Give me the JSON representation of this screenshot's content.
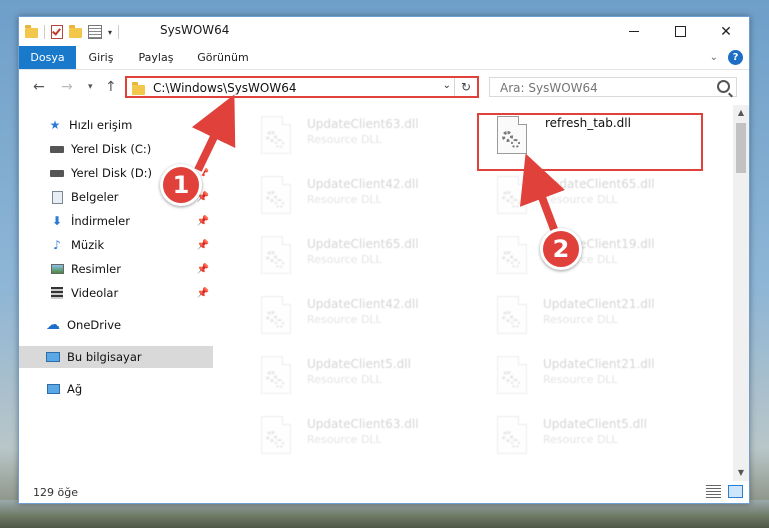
{
  "window": {
    "title": "SysWOW64"
  },
  "ribbon": {
    "tabs": [
      "Dosya",
      "Giriş",
      "Paylaş",
      "Görünüm"
    ],
    "help": "?"
  },
  "address": {
    "path": "C:\\Windows\\SysWOW64"
  },
  "search": {
    "placeholder": "Ara: SysWOW64"
  },
  "sidebar": {
    "items": [
      {
        "label": "Hızlı erişim",
        "icon": "star-icon"
      },
      {
        "label": "Yerel Disk (C:)",
        "icon": "drive-icon"
      },
      {
        "label": "Yerel Disk (D:)",
        "icon": "drive-icon"
      },
      {
        "label": "Belgeler",
        "icon": "documents-icon"
      },
      {
        "label": "İndirmeler",
        "icon": "download-icon"
      },
      {
        "label": "Müzik",
        "icon": "music-icon"
      },
      {
        "label": "Resimler",
        "icon": "pictures-icon"
      },
      {
        "label": "Videolar",
        "icon": "videos-icon"
      },
      {
        "label": "OneDrive",
        "icon": "cloud-icon"
      },
      {
        "label": "Bu bilgisayar",
        "icon": "computer-icon"
      },
      {
        "label": "Ağ",
        "icon": "network-icon"
      }
    ]
  },
  "files": [
    {
      "name": "UpdateClient63.dll",
      "type": "Resource DLL"
    },
    {
      "name": "refresh_tab.dll",
      "type": ""
    },
    {
      "name": "UpdateClient42.dll",
      "type": "Resource DLL"
    },
    {
      "name": "UpdateClient65.dll",
      "type": "Resource DLL"
    },
    {
      "name": "UpdateClient65.dll",
      "type": "Resource DLL"
    },
    {
      "name": "UpdateClient19.dll",
      "type": "Resource DLL"
    },
    {
      "name": "UpdateClient42.dll",
      "type": "Resource DLL"
    },
    {
      "name": "UpdateClient21.dll",
      "type": "Resource DLL"
    },
    {
      "name": "UpdateClient5.dll",
      "type": "Resource DLL"
    },
    {
      "name": "UpdateClient21.dll",
      "type": "Resource DLL"
    },
    {
      "name": "UpdateClient63.dll",
      "type": "Resource DLL"
    },
    {
      "name": "UpdateClient5.dll",
      "type": "Resource DLL"
    }
  ],
  "status": {
    "count": "129 öğe"
  },
  "annotations": {
    "marker1": "1",
    "marker2": "2"
  },
  "colors": {
    "accent": "#1979ca",
    "highlight": "#e0413b",
    "selected": "#d9d9d9"
  }
}
